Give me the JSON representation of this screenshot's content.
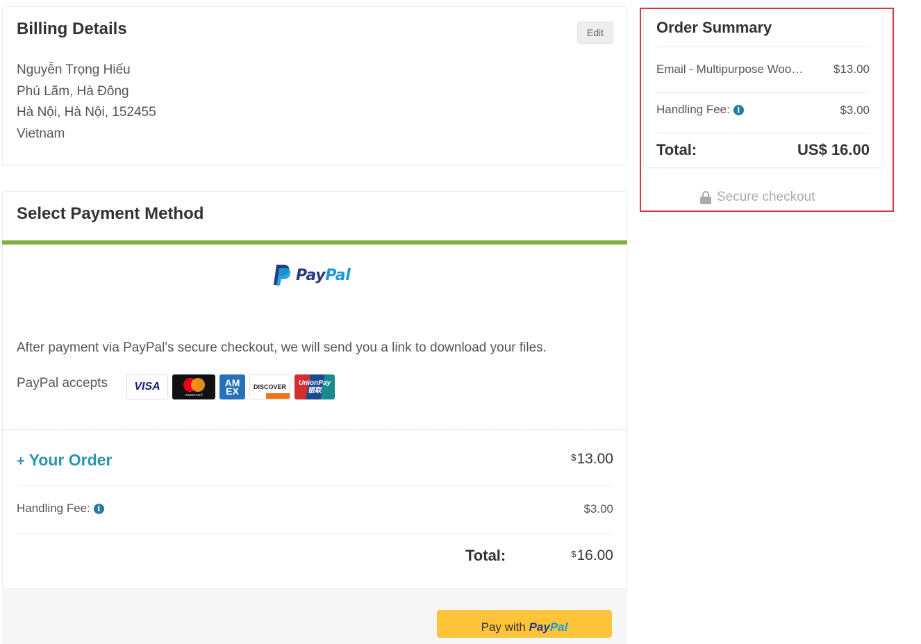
{
  "billing": {
    "title": "Billing Details",
    "edit_label": "Edit",
    "address_lines": [
      "Nguyễn Trọng Hiếu",
      "Phú Lãm, Hà Đông",
      "Hà Nội, Hà Nội, 152455",
      "Vietnam"
    ]
  },
  "payment": {
    "title": "Select Payment Method",
    "accent_color": "#7fb241",
    "paypal_logo": {
      "pay": "Pay",
      "pal": "Pal"
    },
    "description": "After payment via PayPal's secure checkout, we will send you a link to download your files.",
    "accepts_label": "PayPal accepts",
    "card_logos": {
      "visa": "VISA",
      "mastercard": "mastercard",
      "amex_line1": "AM",
      "amex_line2": "EX",
      "discover": "DISCOVER",
      "unionpay_line1": "UnionPay",
      "unionpay_line2": "银联"
    },
    "your_order": {
      "plus": "+",
      "label": "Your Order",
      "currency": "$",
      "amount": "13.00"
    },
    "handling_fee": {
      "label": "Handling Fee:",
      "amount": "$3.00"
    },
    "total": {
      "label": "Total:",
      "currency": "$",
      "amount": "16.00"
    },
    "pay_button": {
      "prefix": "Pay with ",
      "pay": "Pay",
      "pal": "Pal"
    }
  },
  "summary": {
    "title": "Order Summary",
    "item": {
      "name": "Email - Multipurpose Woo…",
      "amount": "$13.00"
    },
    "handling_fee": {
      "label": "Handling Fee:",
      "amount": "$3.00"
    },
    "total": {
      "label": "Total:",
      "amount": "US$ 16.00"
    },
    "secure_label": "Secure checkout",
    "highlight_color": "#d9363e"
  },
  "icons": {
    "info": "info-icon",
    "lock": "lock-icon"
  },
  "colors": {
    "link": "#2a94b2",
    "paypal_button": "#ffc439"
  }
}
